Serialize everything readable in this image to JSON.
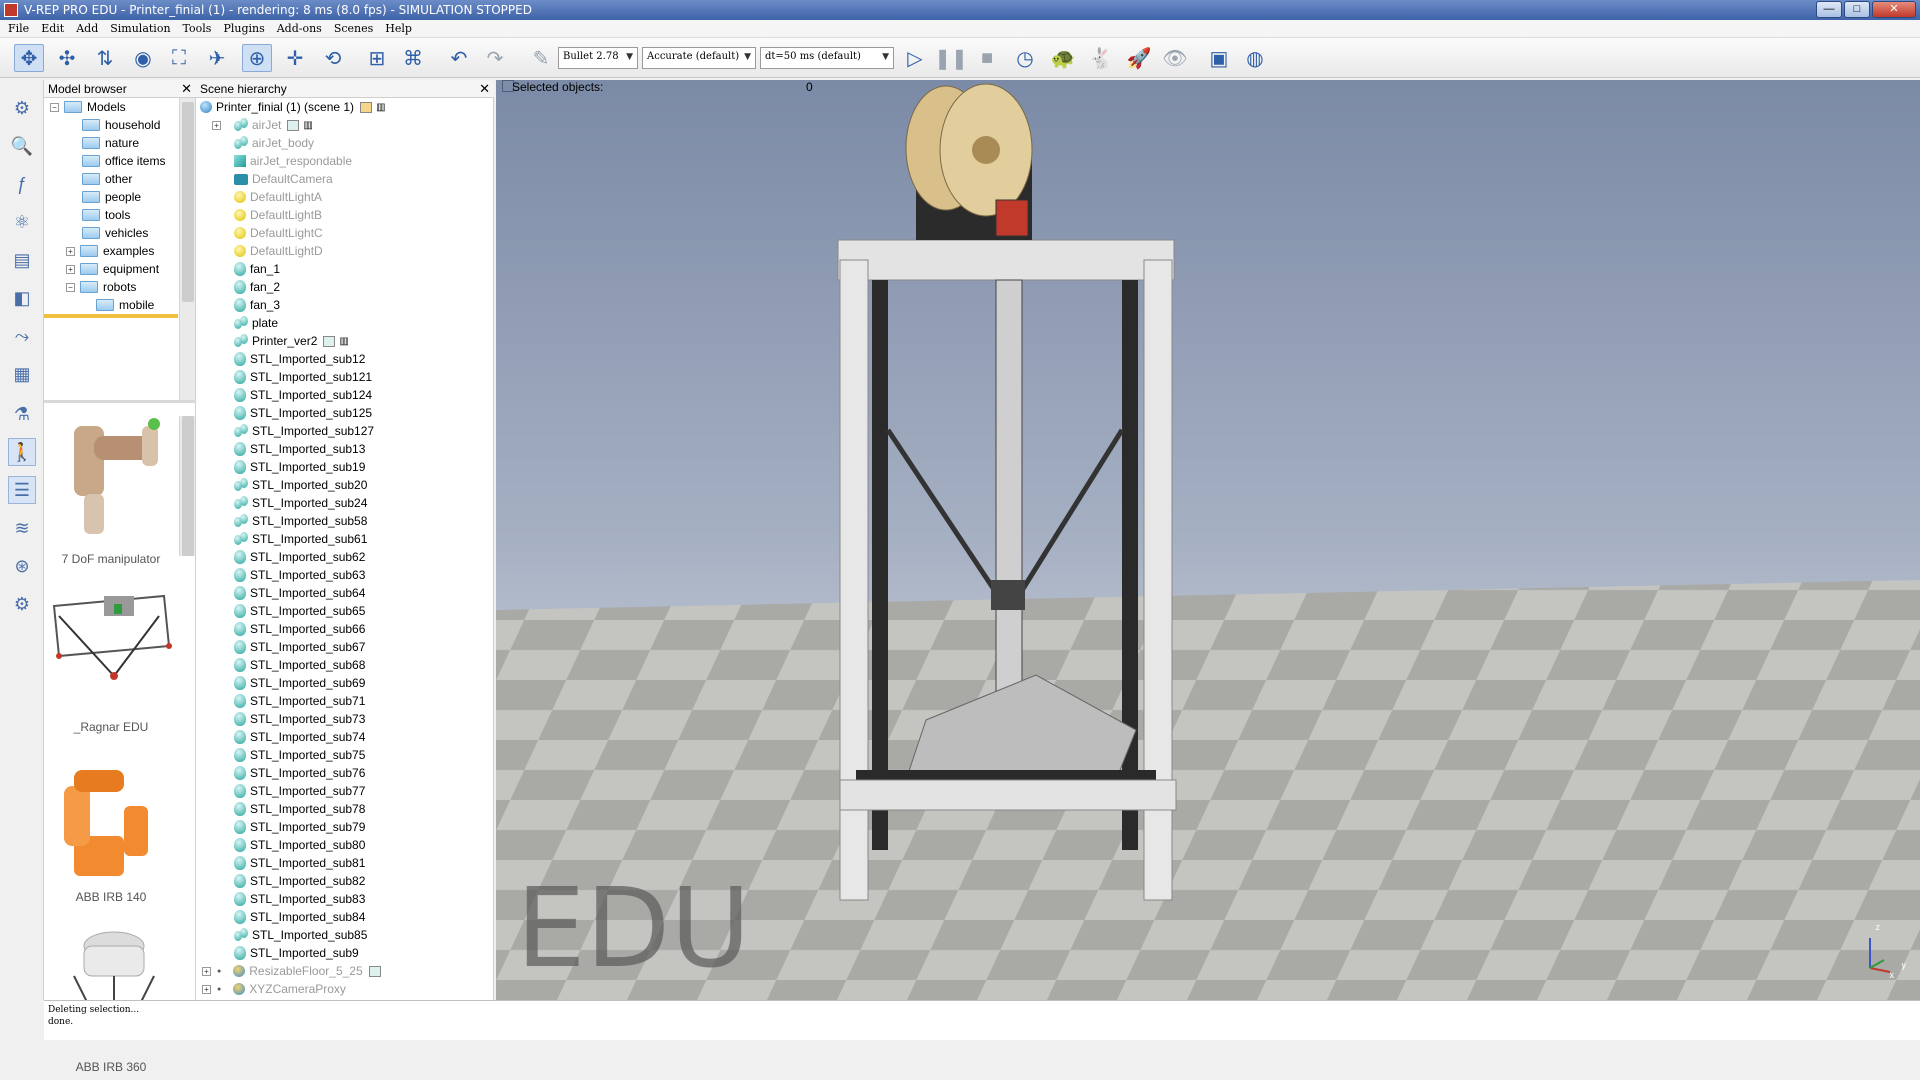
{
  "window": {
    "title": "V-REP PRO EDU - Printer_finial (1) - rendering: 8 ms (8.0 fps) - SIMULATION STOPPED",
    "minimize": "—",
    "maximize": "□",
    "close": "✕"
  },
  "menu": [
    "File",
    "Edit",
    "Add",
    "Simulation",
    "Tools",
    "Plugins",
    "Add-ons",
    "Scenes",
    "Help"
  ],
  "toolbar": {
    "engine": "Bullet 2.78",
    "accuracy": "Accurate (default)",
    "timestep": "dt=50 ms (default)"
  },
  "model_browser": {
    "title": "Model browser",
    "root": "Models",
    "folders": [
      "household",
      "nature",
      "office items",
      "other",
      "people",
      "tools",
      "vehicles",
      "examples",
      "equipment",
      "robots",
      "mobile"
    ],
    "thumbnails": [
      "7 DoF manipulator",
      "_Ragnar EDU",
      "ABB IRB 140",
      "ABB IRB 360"
    ]
  },
  "scene_hierarchy": {
    "title": "Scene hierarchy",
    "scene": "Printer_finial (1) (scene 1)",
    "items": [
      {
        "label": "airJet",
        "dim": true,
        "icon": "group"
      },
      {
        "label": "airJet_body",
        "dim": true,
        "icon": "group"
      },
      {
        "label": "airJet_respondable",
        "dim": true,
        "icon": "cube"
      },
      {
        "label": "DefaultCamera",
        "dim": true,
        "icon": "camera"
      },
      {
        "label": "DefaultLightA",
        "dim": true,
        "icon": "light"
      },
      {
        "label": "DefaultLightB",
        "dim": true,
        "icon": "light"
      },
      {
        "label": "DefaultLightC",
        "dim": true,
        "icon": "light"
      },
      {
        "label": "DefaultLightD",
        "dim": true,
        "icon": "light"
      },
      {
        "label": "fan_1",
        "dim": false,
        "icon": "shape"
      },
      {
        "label": "fan_2",
        "dim": false,
        "icon": "shape"
      },
      {
        "label": "fan_3",
        "dim": false,
        "icon": "shape"
      },
      {
        "label": "plate",
        "dim": false,
        "icon": "group"
      },
      {
        "label": "Printer_ver2",
        "dim": false,
        "icon": "group"
      },
      {
        "label": "STL_Imported_sub12",
        "dim": false,
        "icon": "shape"
      },
      {
        "label": "STL_Imported_sub121",
        "dim": false,
        "icon": "shape"
      },
      {
        "label": "STL_Imported_sub124",
        "dim": false,
        "icon": "shape"
      },
      {
        "label": "STL_Imported_sub125",
        "dim": false,
        "icon": "shape"
      },
      {
        "label": "STL_Imported_sub127",
        "dim": false,
        "icon": "group"
      },
      {
        "label": "STL_Imported_sub13",
        "dim": false,
        "icon": "shape"
      },
      {
        "label": "STL_Imported_sub19",
        "dim": false,
        "icon": "shape"
      },
      {
        "label": "STL_Imported_sub20",
        "dim": false,
        "icon": "group"
      },
      {
        "label": "STL_Imported_sub24",
        "dim": false,
        "icon": "group"
      },
      {
        "label": "STL_Imported_sub58",
        "dim": false,
        "icon": "group"
      },
      {
        "label": "STL_Imported_sub61",
        "dim": false,
        "icon": "group"
      },
      {
        "label": "STL_Imported_sub62",
        "dim": false,
        "icon": "shape"
      },
      {
        "label": "STL_Imported_sub63",
        "dim": false,
        "icon": "shape"
      },
      {
        "label": "STL_Imported_sub64",
        "dim": false,
        "icon": "shape"
      },
      {
        "label": "STL_Imported_sub65",
        "dim": false,
        "icon": "shape"
      },
      {
        "label": "STL_Imported_sub66",
        "dim": false,
        "icon": "shape"
      },
      {
        "label": "STL_Imported_sub67",
        "dim": false,
        "icon": "shape"
      },
      {
        "label": "STL_Imported_sub68",
        "dim": false,
        "icon": "shape"
      },
      {
        "label": "STL_Imported_sub69",
        "dim": false,
        "icon": "shape"
      },
      {
        "label": "STL_Imported_sub71",
        "dim": false,
        "icon": "shape"
      },
      {
        "label": "STL_Imported_sub73",
        "dim": false,
        "icon": "shape"
      },
      {
        "label": "STL_Imported_sub74",
        "dim": false,
        "icon": "shape"
      },
      {
        "label": "STL_Imported_sub75",
        "dim": false,
        "icon": "shape"
      },
      {
        "label": "STL_Imported_sub76",
        "dim": false,
        "icon": "shape"
      },
      {
        "label": "STL_Imported_sub77",
        "dim": false,
        "icon": "shape"
      },
      {
        "label": "STL_Imported_sub78",
        "dim": false,
        "icon": "shape"
      },
      {
        "label": "STL_Imported_sub79",
        "dim": false,
        "icon": "shape"
      },
      {
        "label": "STL_Imported_sub80",
        "dim": false,
        "icon": "shape"
      },
      {
        "label": "STL_Imported_sub81",
        "dim": false,
        "icon": "shape"
      },
      {
        "label": "STL_Imported_sub82",
        "dim": false,
        "icon": "shape"
      },
      {
        "label": "STL_Imported_sub83",
        "dim": false,
        "icon": "shape"
      },
      {
        "label": "STL_Imported_sub84",
        "dim": false,
        "icon": "shape"
      },
      {
        "label": "STL_Imported_sub85",
        "dim": false,
        "icon": "group"
      },
      {
        "label": "STL_Imported_sub9",
        "dim": false,
        "icon": "shape"
      },
      {
        "label": "ResizableFloor_5_25",
        "dim": true,
        "icon": "floor"
      },
      {
        "label": "XYZCameraProxy",
        "dim": true,
        "icon": "floor"
      }
    ]
  },
  "viewport": {
    "selected_label": "Selected objects:",
    "selected_count": "0",
    "watermark": "EDU",
    "axis_z": "z",
    "axis_x": "x",
    "axis_y": "y"
  },
  "status": {
    "line1": "Deleting selection...",
    "line2": "done."
  },
  "colors": {
    "title_bar": "#3f63a8",
    "sky": "#8d9ab2",
    "floor": "#b9b9b5",
    "printer_frame": "#e6e6e6",
    "spool": "#d9c08a"
  }
}
